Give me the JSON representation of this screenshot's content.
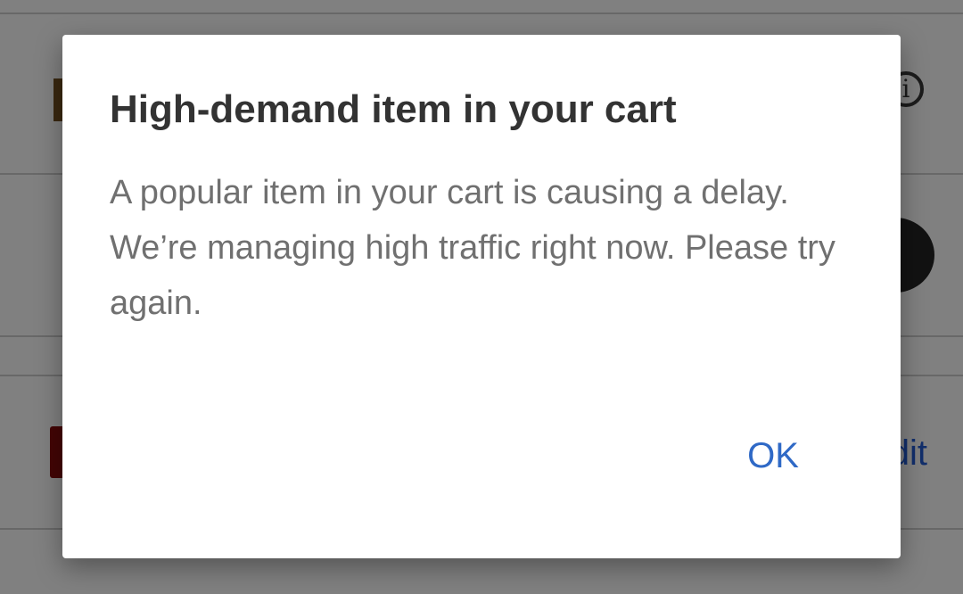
{
  "background": {
    "info_icon_glyph": "i",
    "edit_link_label": "Edit"
  },
  "dialog": {
    "title": "High-demand item in your cart",
    "message": "A popular item in your cart is causing a delay. We’re managing high traffic right now. Please try again.",
    "ok_label": "OK"
  },
  "colors": {
    "link_blue": "#2f69c6",
    "title_text": "#333333",
    "body_text": "#707070"
  }
}
